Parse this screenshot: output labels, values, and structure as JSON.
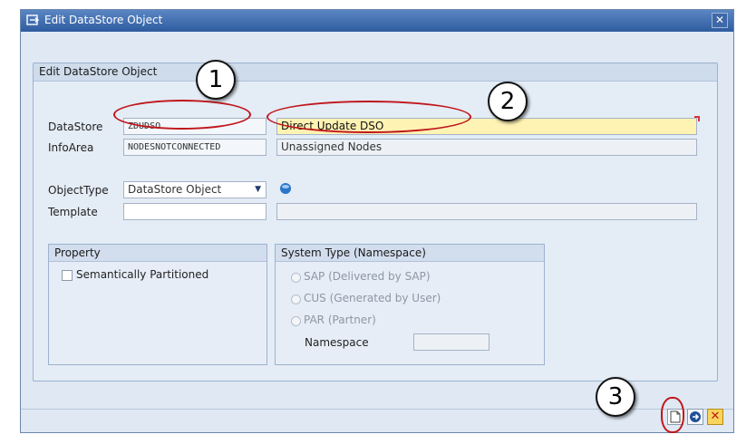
{
  "window": {
    "title": "Edit DataStore Object"
  },
  "group_main": {
    "title": "Edit DataStore Object"
  },
  "fields": {
    "datastore": {
      "label": "DataStore",
      "value": "ZDUDSO",
      "description": "Direct Update DSO"
    },
    "infoarea": {
      "label": "InfoArea",
      "value": "NODESNOTCONNECTED",
      "description": "Unassigned Nodes"
    },
    "objecttype": {
      "label": "ObjectType",
      "value": "DataStore Object"
    },
    "template": {
      "label": "Template",
      "value": "",
      "description": ""
    }
  },
  "property": {
    "title": "Property",
    "semantically_partitioned": {
      "label": "Semantically Partitioned",
      "checked": false
    }
  },
  "system_type": {
    "title": "System Type (Namespace)",
    "options": [
      {
        "label": "SAP (Delivered by SAP)"
      },
      {
        "label": "CUS (Generated by User)"
      },
      {
        "label": "PAR (Partner)"
      }
    ],
    "namespace_label": "Namespace",
    "namespace_value": ""
  },
  "annotations": [
    "1",
    "2",
    "3"
  ],
  "toolbar": {
    "create_icon": "create-document-icon",
    "transfer_icon": "transfer-icon",
    "cancel_icon": "cancel-icon"
  },
  "colors": {
    "annotation_red": "#c0161b",
    "highlight_yellow": "#fff3b3",
    "title_blue": "#2f5c9f"
  }
}
